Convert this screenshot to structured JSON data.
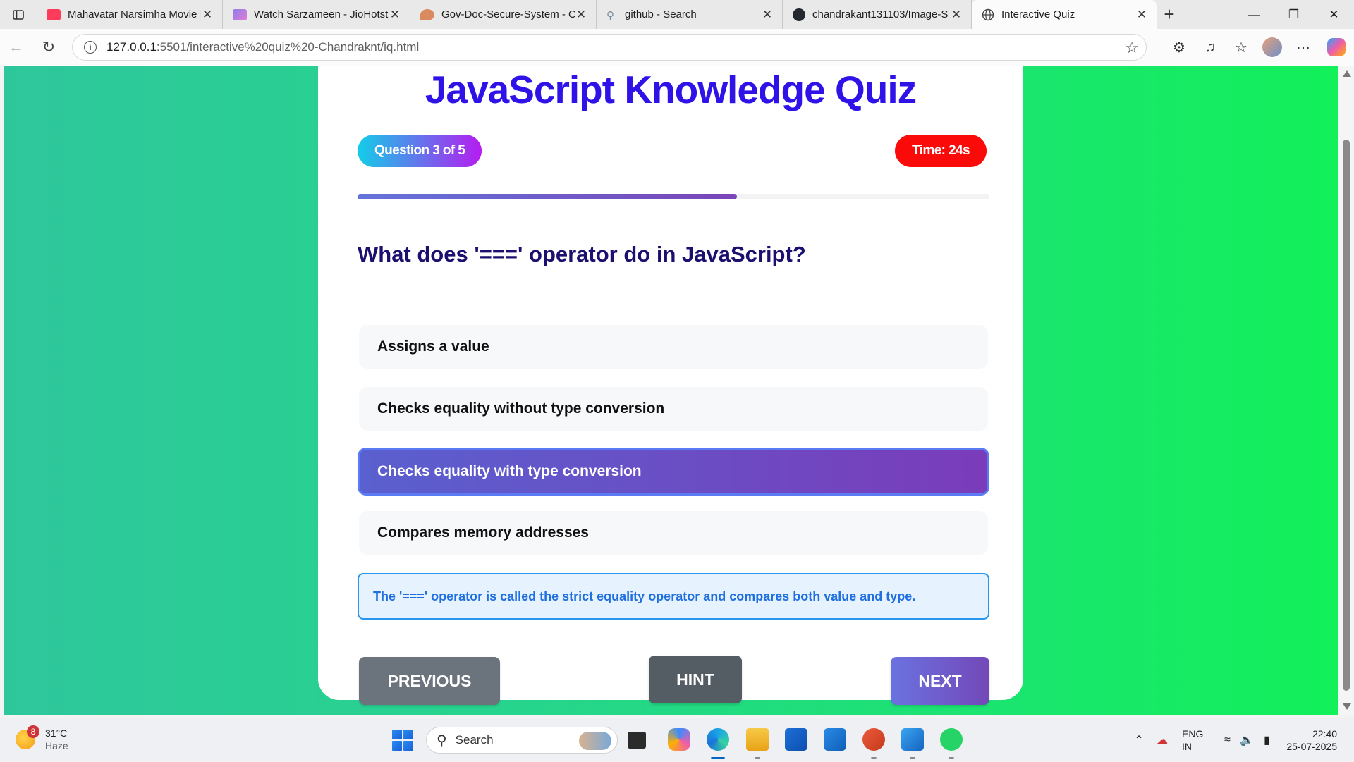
{
  "browser": {
    "tabs": [
      {
        "title": "Mahavatar Narsimha Movie |",
        "favicon": "youtube-icon",
        "color": "#ff3b5c"
      },
      {
        "title": "Watch Sarzameen - JioHotst",
        "favicon": "jiohotstar-icon",
        "color": "#8b7fe8"
      },
      {
        "title": "Gov-Doc-Secure-System - Cl",
        "favicon": "claude-icon",
        "color": "#d98b5f"
      },
      {
        "title": "github - Search",
        "favicon": "search-icon",
        "color": "#9aa0a6"
      },
      {
        "title": "chandrakant131103/Image-S",
        "favicon": "github-icon",
        "color": "#24292f"
      },
      {
        "title": "Interactive Quiz",
        "favicon": "globe-icon",
        "color": "#555555"
      }
    ],
    "url_host": "127.0.0.1",
    "url_rest": ":5501/interactive%20quiz%20-Chandraknt/iq.html"
  },
  "quiz": {
    "title": "JavaScript Knowledge Quiz",
    "question_counter": "Question 3 of 5",
    "timer": "Time: 24s",
    "progress": 0.6,
    "question": "What does '===' operator do in JavaScript?",
    "options": [
      "Assigns a value",
      "Checks equality without type conversion",
      "Checks equality with type conversion",
      "Compares memory addresses"
    ],
    "selected_index": 2,
    "feedback": "The '===' operator is called the strict equality operator and compares both value and type.",
    "buttons": {
      "previous": "PREVIOUS",
      "hint": "HINT",
      "next": "NEXT"
    },
    "colors": {
      "title": "#2e12e8",
      "timer": "#fb0a0a",
      "feedback_border": "#2997ee"
    }
  },
  "taskbar": {
    "weather_temp": "31°C",
    "weather_desc": "Haze",
    "weather_badge": "8",
    "search_placeholder": "Search",
    "lang_1": "ENG",
    "lang_2": "IN",
    "time": "22:40",
    "date": "25-07-2025"
  }
}
